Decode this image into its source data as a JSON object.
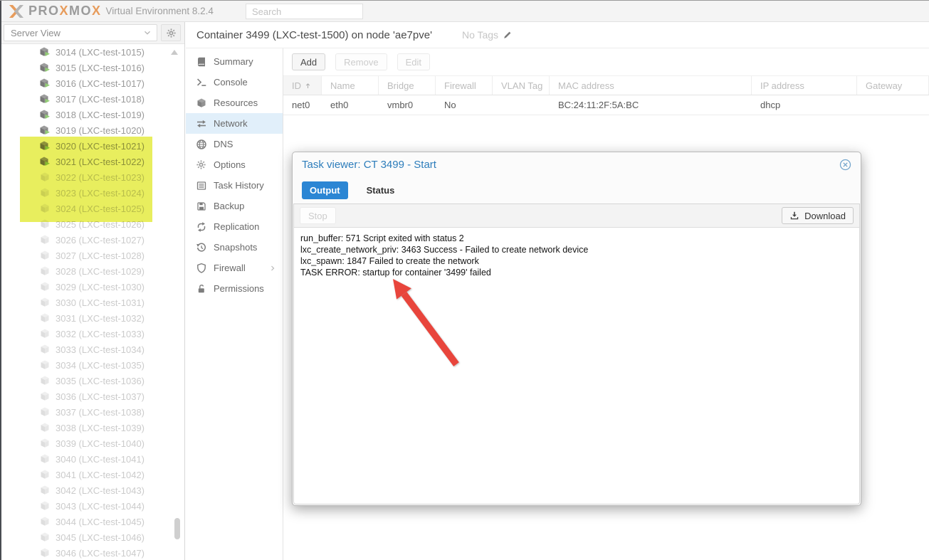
{
  "topbar": {
    "brand_parts": [
      "PRO",
      "X",
      "MO",
      "X"
    ],
    "product": "Virtual Environment 8.2.4",
    "search_placeholder": "Search"
  },
  "sidebar": {
    "view_label": "Server View",
    "items": [
      {
        "label": "3014 (LXC-test-1015)",
        "status": "running"
      },
      {
        "label": "3015 (LXC-test-1016)",
        "status": "running"
      },
      {
        "label": "3016 (LXC-test-1017)",
        "status": "running"
      },
      {
        "label": "3017 (LXC-test-1018)",
        "status": "running"
      },
      {
        "label": "3018 (LXC-test-1019)",
        "status": "running"
      },
      {
        "label": "3019 (LXC-test-1020)",
        "status": "running"
      },
      {
        "label": "3020 (LXC-test-1021)",
        "status": "running"
      },
      {
        "label": "3021 (LXC-test-1022)",
        "status": "running"
      },
      {
        "label": "3022 (LXC-test-1023)",
        "status": "stopped"
      },
      {
        "label": "3023 (LXC-test-1024)",
        "status": "stopped"
      },
      {
        "label": "3024 (LXC-test-1025)",
        "status": "stopped"
      },
      {
        "label": "3025 (LXC-test-1026)",
        "status": "stopped"
      },
      {
        "label": "3026 (LXC-test-1027)",
        "status": "stopped"
      },
      {
        "label": "3027 (LXC-test-1028)",
        "status": "stopped"
      },
      {
        "label": "3028 (LXC-test-1029)",
        "status": "stopped"
      },
      {
        "label": "3029 (LXC-test-1030)",
        "status": "stopped"
      },
      {
        "label": "3030 (LXC-test-1031)",
        "status": "stopped"
      },
      {
        "label": "3031 (LXC-test-1032)",
        "status": "stopped"
      },
      {
        "label": "3032 (LXC-test-1033)",
        "status": "stopped"
      },
      {
        "label": "3033 (LXC-test-1034)",
        "status": "stopped"
      },
      {
        "label": "3034 (LXC-test-1035)",
        "status": "stopped"
      },
      {
        "label": "3035 (LXC-test-1036)",
        "status": "stopped"
      },
      {
        "label": "3036 (LXC-test-1037)",
        "status": "stopped"
      },
      {
        "label": "3037 (LXC-test-1038)",
        "status": "stopped"
      },
      {
        "label": "3038 (LXC-test-1039)",
        "status": "stopped"
      },
      {
        "label": "3039 (LXC-test-1040)",
        "status": "stopped"
      },
      {
        "label": "3040 (LXC-test-1041)",
        "status": "stopped"
      },
      {
        "label": "3041 (LXC-test-1042)",
        "status": "stopped"
      },
      {
        "label": "3042 (LXC-test-1043)",
        "status": "stopped"
      },
      {
        "label": "3043 (LXC-test-1044)",
        "status": "stopped"
      },
      {
        "label": "3044 (LXC-test-1045)",
        "status": "stopped"
      },
      {
        "label": "3045 (LXC-test-1046)",
        "status": "stopped"
      },
      {
        "label": "3046 (LXC-test-1047)",
        "status": "stopped"
      }
    ]
  },
  "header": {
    "title": "Container 3499 (LXC-test-1500) on node 'ae7pve'",
    "tags_label": "No Tags"
  },
  "nav": {
    "items": [
      {
        "label": "Summary",
        "icon": "book"
      },
      {
        "label": "Console",
        "icon": "terminal"
      },
      {
        "label": "Resources",
        "icon": "cube"
      },
      {
        "label": "Network",
        "icon": "network",
        "selected": true
      },
      {
        "label": "DNS",
        "icon": "globe"
      },
      {
        "label": "Options",
        "icon": "gear"
      },
      {
        "label": "Task History",
        "icon": "list"
      },
      {
        "label": "Backup",
        "icon": "floppy"
      },
      {
        "label": "Replication",
        "icon": "replication"
      },
      {
        "label": "Snapshots",
        "icon": "history"
      },
      {
        "label": "Firewall",
        "icon": "shield",
        "submenu": true
      },
      {
        "label": "Permissions",
        "icon": "unlock"
      }
    ]
  },
  "network": {
    "toolbar": [
      {
        "label": "Add",
        "enabled": true
      },
      {
        "label": "Remove",
        "enabled": false
      },
      {
        "label": "Edit",
        "enabled": false
      }
    ],
    "table": {
      "columns": [
        {
          "label": "ID",
          "sorted": "asc"
        },
        {
          "label": "Name"
        },
        {
          "label": "Bridge"
        },
        {
          "label": "Firewall"
        },
        {
          "label": "VLAN Tag"
        },
        {
          "label": "MAC address"
        },
        {
          "label": "IP address"
        },
        {
          "label": "Gateway"
        }
      ],
      "rows": [
        [
          "net0",
          "eth0",
          "vmbr0",
          "No",
          "",
          "BC:24:11:2F:5A:BC",
          "dhcp",
          ""
        ]
      ]
    }
  },
  "task_viewer": {
    "title": "Task viewer: CT 3499 - Start",
    "tabs": [
      {
        "label": "Output",
        "active": true
      },
      {
        "label": "Status",
        "active": false
      }
    ],
    "stop_label": "Stop",
    "download_label": "Download",
    "log_lines": [
      "run_buffer: 571 Script exited with status 2",
      "lxc_create_network_priv: 3463 Success - Failed to create network device",
      "lxc_spawn: 1847 Failed to create the network",
      "TASK ERROR: startup for container '3499' failed"
    ]
  },
  "annotations": {
    "highlight_color": "#e8ee5e",
    "highlighted_items": [
      "3020 (LXC-test-1021)",
      "3021 (LXC-test-1022)",
      "3022 (LXC-test-1023)",
      "3023 (LXC-test-1024)",
      "3024 (LXC-test-1025)"
    ],
    "arrow_color": "#e8453c",
    "arrow_points_to": "TASK ERROR: startup for container '3499' failed"
  },
  "colors": {
    "brand_orange": "#e79c5c",
    "active_tab_bg": "#2b86d4",
    "modal_title_blue": "#2d7dbb",
    "selected_nav_bg": "#e1effa"
  }
}
